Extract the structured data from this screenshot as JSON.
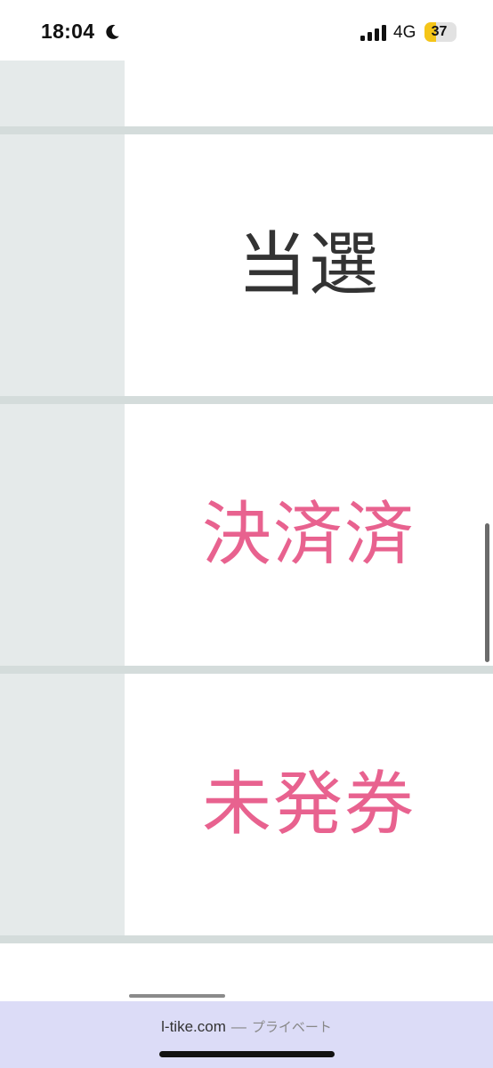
{
  "status_bar": {
    "time": "18:04",
    "focus_icon": "moon-icon",
    "signal_icon": "cellular-signal-icon",
    "network": "4G",
    "battery_level": "37",
    "battery_fraction": 0.37,
    "battery_color": "#f5c518"
  },
  "table": {
    "rows": [
      {
        "status": "当選",
        "color": "#333333"
      },
      {
        "status": "決済済",
        "color": "#e8628f"
      },
      {
        "status": "未発券",
        "color": "#e8628f"
      }
    ]
  },
  "address_bar": {
    "domain": "l-tike.com",
    "separator": "—",
    "mode": "プライベート"
  }
}
